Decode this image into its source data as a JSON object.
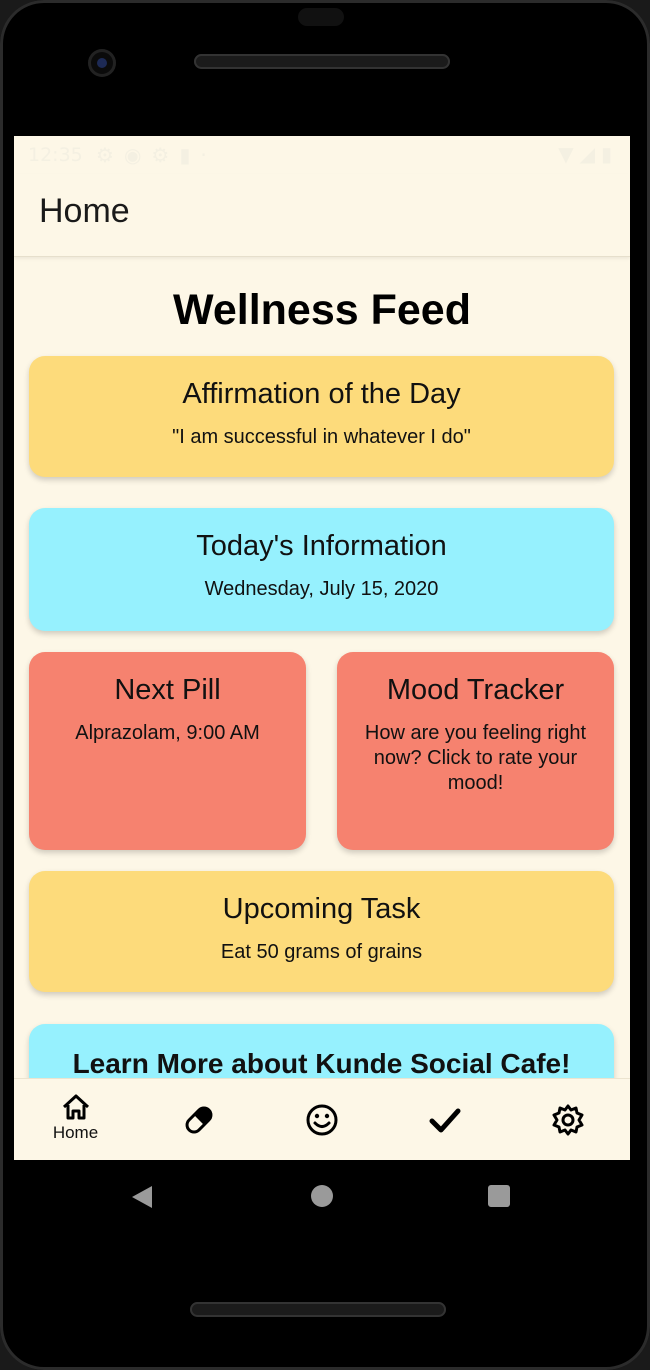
{
  "status_bar": {
    "time": "12:35",
    "left_icons": [
      "gear-icon",
      "android-icon",
      "shield-icon",
      "sd-card-icon",
      "dot-icon"
    ],
    "right_icons": [
      "wifi-icon",
      "signal-icon",
      "battery-icon"
    ]
  },
  "app_bar": {
    "title": "Home"
  },
  "feed": {
    "title": "Wellness Feed",
    "cards": {
      "affirmation": {
        "title": "Affirmation of the Day",
        "body": "\"I am successful in whatever I do\""
      },
      "info": {
        "title": "Today's Information",
        "body": "Wednesday, July 15, 2020"
      },
      "pill": {
        "title": "Next Pill",
        "body": "Alprazolam, 9:00 AM"
      },
      "mood": {
        "title": "Mood Tracker",
        "body": "How are you feeling right now? Click to rate your mood!"
      },
      "task": {
        "title": "Upcoming Task",
        "body": "Eat 50 grams of grains"
      },
      "learn": {
        "title": "Learn More about Kunde Social Cafe!"
      }
    }
  },
  "bottom_nav": {
    "items": [
      {
        "icon": "home-icon",
        "label": "Home",
        "active": true
      },
      {
        "icon": "pill-icon",
        "label": ""
      },
      {
        "icon": "smiley-icon",
        "label": ""
      },
      {
        "icon": "checkmark-icon",
        "label": ""
      },
      {
        "icon": "settings-icon",
        "label": ""
      }
    ]
  },
  "colors": {
    "background": "#fdf7e7",
    "yellow_card": "#fddb7b",
    "cyan_card": "#96f1fe",
    "salmon_card": "#f6826f"
  }
}
